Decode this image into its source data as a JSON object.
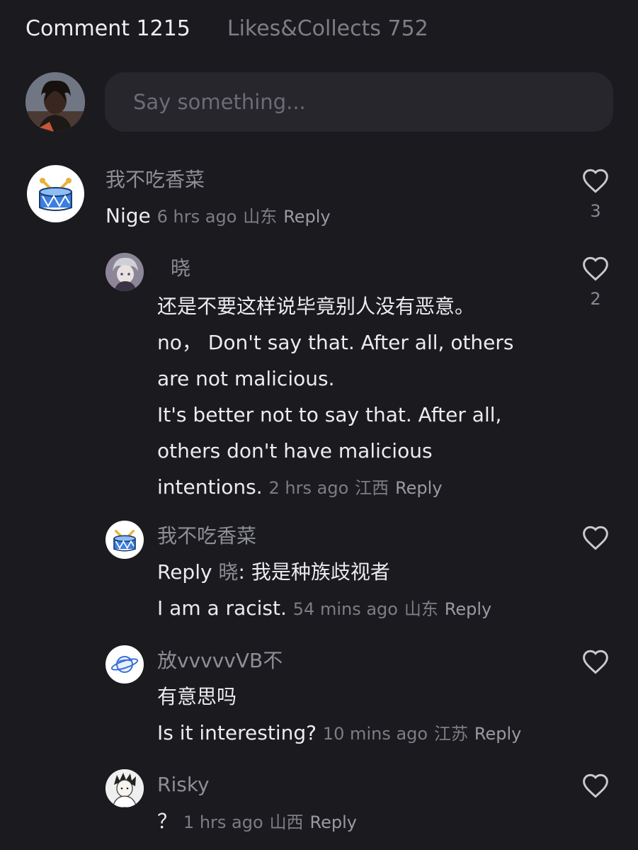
{
  "tabs": {
    "comments": "Comment 1215",
    "likes": "Likes&Collects 752"
  },
  "comment_input": {
    "placeholder": "Say something..."
  },
  "comments": [
    {
      "author": "我不吃香菜",
      "text": "Nige",
      "time": "6 hrs ago",
      "location": "山东",
      "reply_label": "Reply",
      "likes": "3",
      "avatar_icon": "drum-icon"
    }
  ],
  "replies": [
    {
      "author": "晓",
      "lines": [
        "还是不要这样说毕竟别人没有恶意。",
        "no， Don't say that. After all, others",
        "are not malicious.",
        "It's better not to say that. After all,",
        "others don't have malicious",
        "intentions."
      ],
      "time": "2 hrs ago",
      "location": "江西",
      "reply_label": "Reply",
      "likes": "2"
    },
    {
      "author": "我不吃香菜",
      "reply_prefix": "Reply",
      "reply_target": "晓",
      "lines": [
        "我是种族歧视者",
        "I am a racist."
      ],
      "time": "54 mins ago",
      "location": "山东",
      "reply_label": "Reply",
      "avatar_icon": "drum-icon"
    },
    {
      "author": "放vvvvvVB不",
      "lines": [
        "有意思吗",
        "Is it interesting?"
      ],
      "time": "10 mins ago",
      "location": "江苏",
      "reply_label": "Reply",
      "avatar_icon": "planet-icon"
    },
    {
      "author": "Risky",
      "lines": [
        "？"
      ],
      "time": "1 hrs ago",
      "location": "山西",
      "reply_label": "Reply"
    }
  ]
}
